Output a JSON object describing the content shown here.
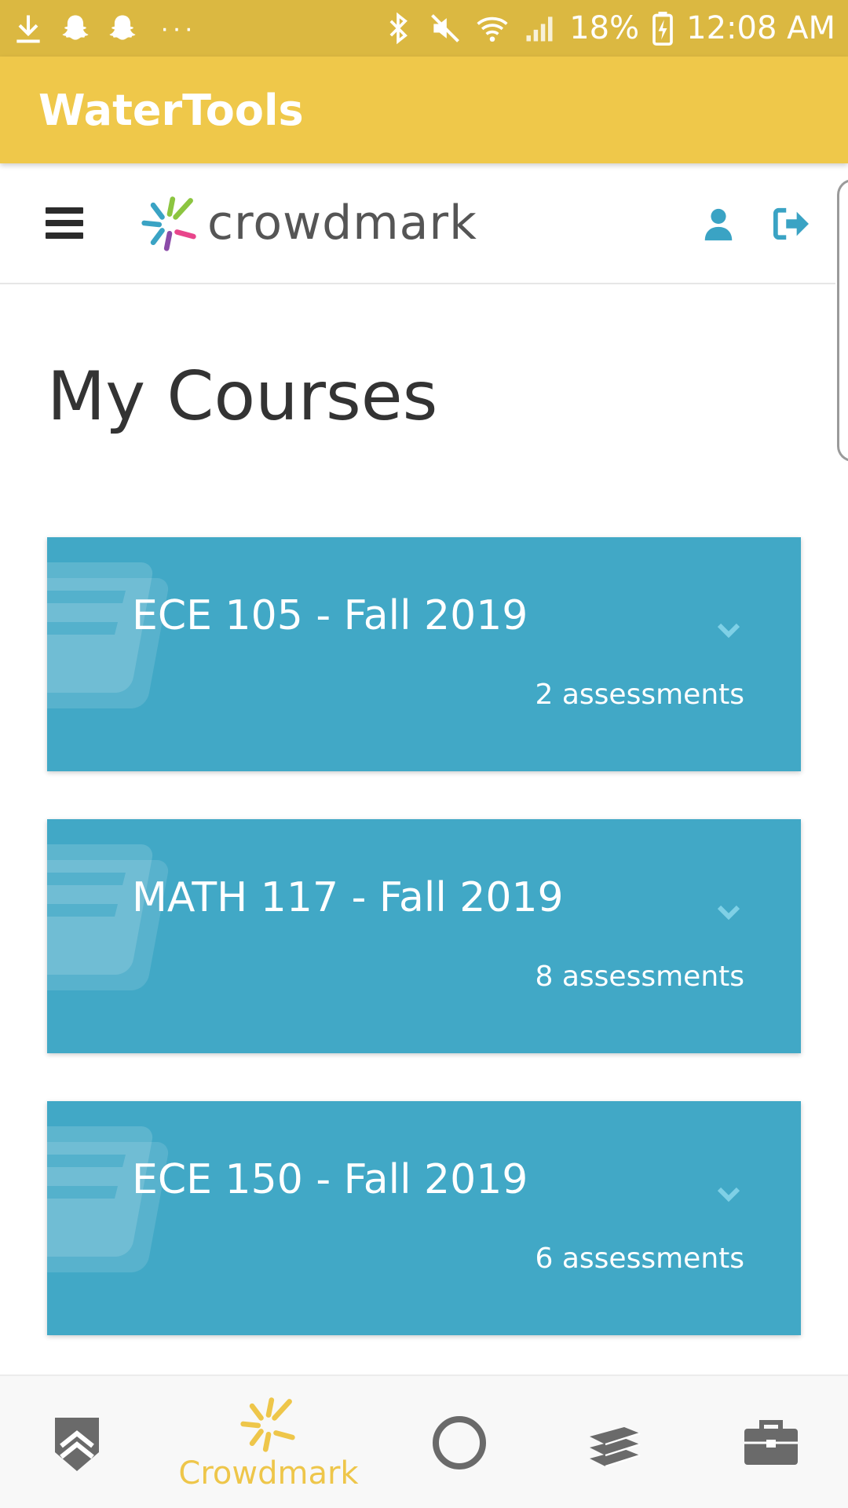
{
  "status_bar": {
    "left_icons": [
      "download-icon",
      "snapchat-icon",
      "snapchat-icon",
      "more-dots-icon"
    ],
    "dots": "···",
    "battery_percent": "18%",
    "time": "12:08 AM",
    "right_icons": [
      "bluetooth-icon",
      "mute-icon",
      "wifi-icon",
      "signal-icon",
      "battery-charging-icon"
    ]
  },
  "app_bar": {
    "title": "WaterTools"
  },
  "header": {
    "menu_icon": "hamburger-menu-icon",
    "logo_text": "crowdmark",
    "user_icon": "user-icon",
    "logout_icon": "sign-out-icon"
  },
  "main": {
    "title": "My Courses",
    "courses": [
      {
        "name": "ECE 105 - Fall 2019",
        "assessments": "2 assessments"
      },
      {
        "name": "MATH 117 - Fall 2019",
        "assessments": "8 assessments"
      },
      {
        "name": "ECE 150 - Fall 2019",
        "assessments": "6 assessments"
      }
    ]
  },
  "bottom_nav": {
    "items": [
      {
        "icon": "shield-chevron-icon",
        "label": ""
      },
      {
        "icon": "crowdmark-burst-icon",
        "label": "Crowdmark",
        "active": true
      },
      {
        "icon": "circle-icon",
        "label": ""
      },
      {
        "icon": "books-icon",
        "label": ""
      },
      {
        "icon": "briefcase-icon",
        "label": ""
      }
    ]
  },
  "colors": {
    "status_bar": "#dbb841",
    "app_bar": "#efc84a",
    "card": "#41a8c6",
    "accent_icon": "#3aa3c4",
    "active_nav": "#eec64a",
    "inactive_nav": "#6a6a6a"
  }
}
